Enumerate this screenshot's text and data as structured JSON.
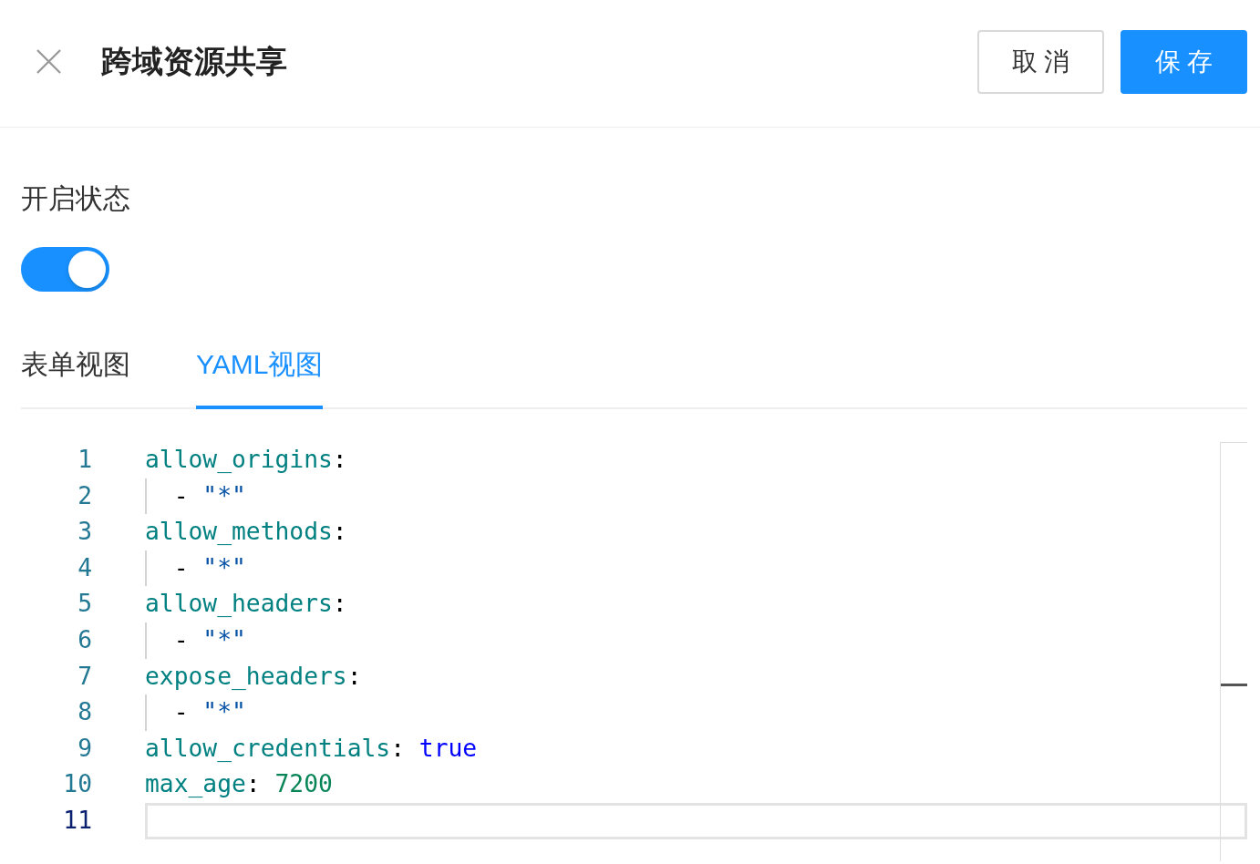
{
  "header": {
    "title": "跨域资源共享",
    "buttons": [
      {
        "label": "取 消",
        "kind": "default"
      },
      {
        "label": "保 存",
        "kind": "primary"
      }
    ]
  },
  "status_field": {
    "label": "开启状态",
    "on": true
  },
  "tabs": [
    {
      "label": "表单视图",
      "selected": false
    },
    {
      "label": "YAML视图",
      "selected": true
    }
  ],
  "editor": {
    "lines": [
      {
        "number": "1",
        "current": false,
        "tokens": [
          {
            "kind": "key",
            "text": "allow_origins"
          },
          {
            "kind": "punct",
            "text": ":"
          }
        ],
        "children": [
          {
            "number": "2",
            "current": false,
            "tokens": [
              {
                "kind": "dash",
                "text": "-"
              },
              {
                "kind": "string",
                "text": "\"*\""
              }
            ]
          }
        ]
      },
      {
        "number": "3",
        "current": false,
        "tokens": [
          {
            "kind": "key",
            "text": "allow_methods"
          },
          {
            "kind": "punct",
            "text": ":"
          }
        ],
        "children": [
          {
            "number": "4",
            "current": false,
            "tokens": [
              {
                "kind": "dash",
                "text": "-"
              },
              {
                "kind": "string",
                "text": "\"*\""
              }
            ]
          }
        ]
      },
      {
        "number": "5",
        "current": false,
        "tokens": [
          {
            "kind": "key",
            "text": "allow_headers"
          },
          {
            "kind": "punct",
            "text": ":"
          }
        ],
        "children": [
          {
            "number": "6",
            "current": false,
            "tokens": [
              {
                "kind": "dash",
                "text": "-"
              },
              {
                "kind": "string",
                "text": "\"*\""
              }
            ]
          }
        ]
      },
      {
        "number": "7",
        "current": false,
        "tokens": [
          {
            "kind": "key",
            "text": "expose_headers"
          },
          {
            "kind": "punct",
            "text": ":"
          }
        ],
        "children": [
          {
            "number": "8",
            "current": false,
            "tokens": [
              {
                "kind": "dash",
                "text": "-"
              },
              {
                "kind": "string",
                "text": "\"*\""
              }
            ]
          }
        ]
      },
      {
        "number": "9",
        "current": false,
        "tokens": [
          {
            "kind": "key",
            "text": "allow_credentials"
          },
          {
            "kind": "punct",
            "text": ":"
          },
          {
            "kind": "bool",
            "text": "true"
          }
        ]
      },
      {
        "number": "10",
        "current": false,
        "tokens": [
          {
            "kind": "key",
            "text": "max_age"
          },
          {
            "kind": "punct",
            "text": ":"
          },
          {
            "kind": "number",
            "text": "7200"
          }
        ]
      },
      {
        "number": "11",
        "current": true
      }
    ]
  }
}
